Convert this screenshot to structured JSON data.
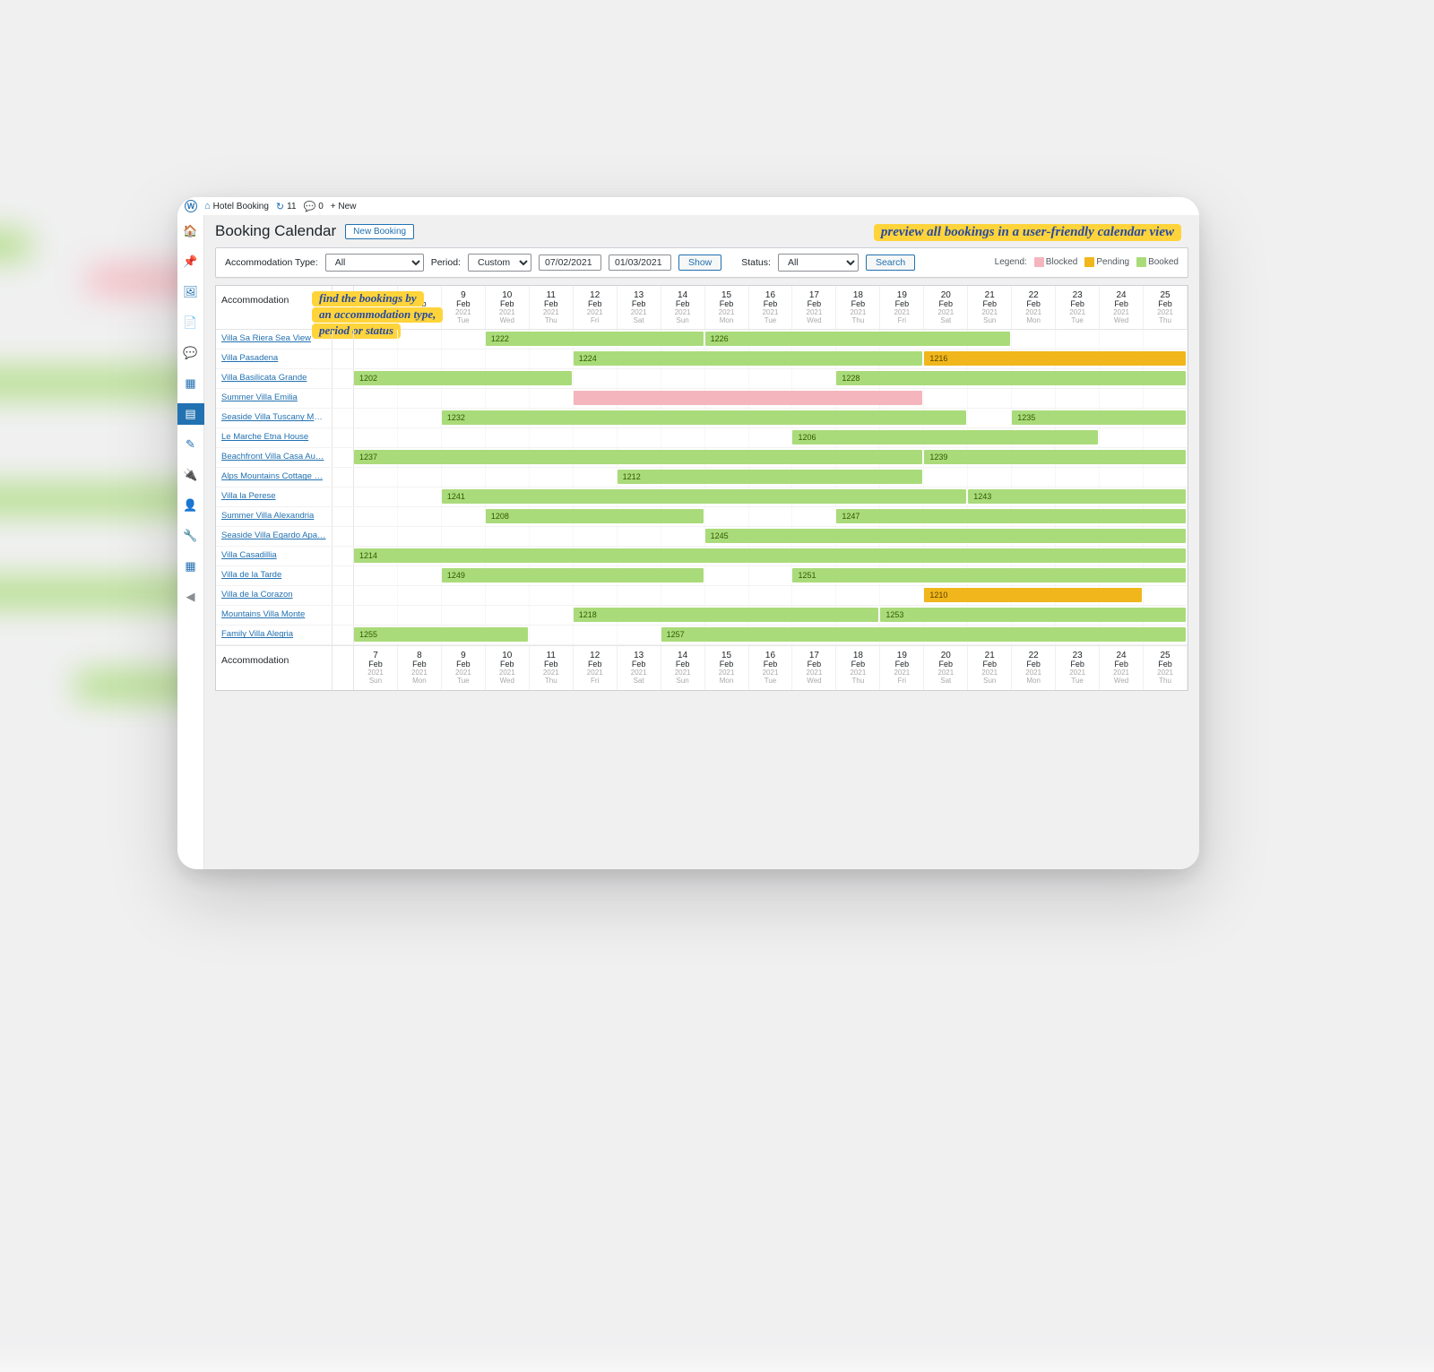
{
  "adminbar": {
    "site": "Hotel Booking",
    "updates": "11",
    "comments": "0",
    "new": "+ New"
  },
  "page": {
    "title": "Booking Calendar",
    "new_booking": "New Booking"
  },
  "annotations": {
    "top": "preview all bookings in a user-friendly calendar view",
    "left1": "find the bookings by",
    "left2": "an accommodation type,",
    "left3": "period or status"
  },
  "filters": {
    "acc_label": "Accommodation Type:",
    "acc_value": "All",
    "period_label": "Period:",
    "period_value": "Custom",
    "date_from": "07/02/2021",
    "date_to": "01/03/2021",
    "show": "Show",
    "status_label": "Status:",
    "status_value": "All",
    "search": "Search",
    "legend_label": "Legend:",
    "legend_blocked": "Blocked",
    "legend_pending": "Pending",
    "legend_booked": "Booked"
  },
  "calendar": {
    "acc_header": "Accommodation",
    "days": [
      {
        "d": "7",
        "m": "Feb",
        "y": "2021",
        "w": "Sun"
      },
      {
        "d": "8",
        "m": "Feb",
        "y": "2021",
        "w": "Mon"
      },
      {
        "d": "9",
        "m": "Feb",
        "y": "2021",
        "w": "Tue"
      },
      {
        "d": "10",
        "m": "Feb",
        "y": "2021",
        "w": "Wed"
      },
      {
        "d": "11",
        "m": "Feb",
        "y": "2021",
        "w": "Thu"
      },
      {
        "d": "12",
        "m": "Feb",
        "y": "2021",
        "w": "Fri"
      },
      {
        "d": "13",
        "m": "Feb",
        "y": "2021",
        "w": "Sat"
      },
      {
        "d": "14",
        "m": "Feb",
        "y": "2021",
        "w": "Sun"
      },
      {
        "d": "15",
        "m": "Feb",
        "y": "2021",
        "w": "Mon"
      },
      {
        "d": "16",
        "m": "Feb",
        "y": "2021",
        "w": "Tue"
      },
      {
        "d": "17",
        "m": "Feb",
        "y": "2021",
        "w": "Wed"
      },
      {
        "d": "18",
        "m": "Feb",
        "y": "2021",
        "w": "Thu"
      },
      {
        "d": "19",
        "m": "Feb",
        "y": "2021",
        "w": "Fri"
      },
      {
        "d": "20",
        "m": "Feb",
        "y": "2021",
        "w": "Sat"
      },
      {
        "d": "21",
        "m": "Feb",
        "y": "2021",
        "w": "Sun"
      },
      {
        "d": "22",
        "m": "Feb",
        "y": "2021",
        "w": "Mon"
      },
      {
        "d": "23",
        "m": "Feb",
        "y": "2021",
        "w": "Tue"
      },
      {
        "d": "24",
        "m": "Feb",
        "y": "2021",
        "w": "Wed"
      },
      {
        "d": "25",
        "m": "Feb",
        "y": "2021",
        "w": "Thu"
      }
    ],
    "rows": [
      {
        "name": "Villa Sa Riera Sea View",
        "bars": [
          {
            "label": "1222",
            "status": "booked",
            "start": 4,
            "span": 5
          },
          {
            "label": "1226",
            "status": "booked",
            "start": 9,
            "span": 7
          }
        ]
      },
      {
        "name": "Villa Pasadena",
        "bars": [
          {
            "label": "1224",
            "status": "booked",
            "start": 6,
            "span": 8
          },
          {
            "label": "1216",
            "status": "pending",
            "start": 14,
            "span": 6
          }
        ]
      },
      {
        "name": "Villa Basilicata Grande",
        "bars": [
          {
            "label": "1202",
            "status": "booked",
            "start": 1,
            "span": 5
          },
          {
            "label": "1228",
            "status": "booked",
            "start": 12,
            "span": 8
          }
        ]
      },
      {
        "name": "Summer Villa Emilia",
        "bars": [
          {
            "label": "",
            "status": "blocked",
            "start": 6,
            "span": 8
          }
        ]
      },
      {
        "name": "Seaside Villa Tuscany Ma…",
        "bars": [
          {
            "label": "1232",
            "status": "booked",
            "start": 3,
            "span": 12
          },
          {
            "label": "1235",
            "status": "booked",
            "start": 16,
            "span": 4
          }
        ]
      },
      {
        "name": "Le Marche Etna House",
        "bars": [
          {
            "label": "1206",
            "status": "booked",
            "start": 11,
            "span": 7
          }
        ]
      },
      {
        "name": "Beachfront Villa Casa Au…",
        "bars": [
          {
            "label": "1237",
            "status": "booked",
            "start": 1,
            "span": 13
          },
          {
            "label": "1239",
            "status": "booked",
            "start": 14,
            "span": 6
          }
        ]
      },
      {
        "name": "Alps Mountains Cottage …",
        "bars": [
          {
            "label": "1212",
            "status": "booked",
            "start": 7,
            "span": 7
          }
        ]
      },
      {
        "name": "Villa la Perese",
        "bars": [
          {
            "label": "1241",
            "status": "booked",
            "start": 3,
            "span": 12
          },
          {
            "label": "1243",
            "status": "booked",
            "start": 15,
            "span": 5
          }
        ]
      },
      {
        "name": "Summer Villa Alexandria",
        "bars": [
          {
            "label": "1208",
            "status": "booked",
            "start": 4,
            "span": 5
          },
          {
            "label": "1247",
            "status": "booked",
            "start": 12,
            "span": 8
          }
        ]
      },
      {
        "name": "Seaside Villa Egardo Apa…",
        "bars": [
          {
            "label": "1245",
            "status": "booked",
            "start": 9,
            "span": 11
          }
        ]
      },
      {
        "name": "Villa Casadillia",
        "bars": [
          {
            "label": "1214",
            "status": "booked",
            "start": 1,
            "span": 19
          }
        ]
      },
      {
        "name": "Villa de la Tarde",
        "bars": [
          {
            "label": "1249",
            "status": "booked",
            "start": 3,
            "span": 6
          },
          {
            "label": "1251",
            "status": "booked",
            "start": 11,
            "span": 9
          }
        ]
      },
      {
        "name": "Villa de la Corazon",
        "bars": [
          {
            "label": "1210",
            "status": "pending",
            "start": 14,
            "span": 5
          }
        ]
      },
      {
        "name": "Mountains Villa Monte",
        "bars": [
          {
            "label": "1218",
            "status": "booked",
            "start": 6,
            "span": 7
          },
          {
            "label": "1253",
            "status": "booked",
            "start": 13,
            "span": 7
          }
        ]
      },
      {
        "name": "Family Villa Alegria",
        "bars": [
          {
            "label": "1255",
            "status": "booked",
            "start": 1,
            "span": 4
          },
          {
            "label": "1257",
            "status": "booked",
            "start": 8,
            "span": 12
          }
        ]
      }
    ]
  }
}
